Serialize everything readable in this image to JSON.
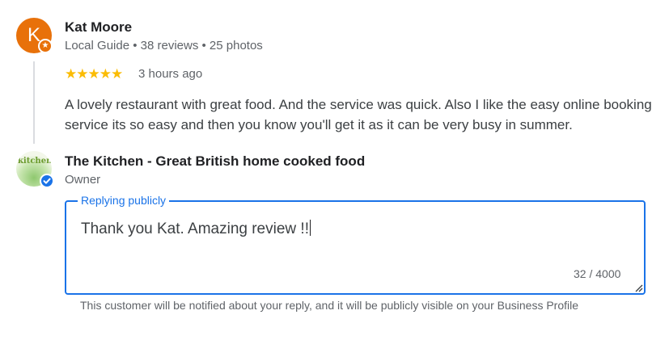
{
  "review": {
    "avatar_letter": "K",
    "reviewer_name": "Kat Moore",
    "reviewer_meta": "Local Guide • 38 reviews • 25 photos",
    "stars": "★★★★★",
    "rating": 5,
    "time": "3 hours ago",
    "text": "A lovely restaurant with great food. And the service was quick. Also I like the easy online booking service its so easy and then you know you'll get it as it can be very busy in summer."
  },
  "owner": {
    "logo_text": "kitchen",
    "name": "The Kitchen - Great British home cooked food",
    "role": "Owner"
  },
  "reply": {
    "legend": "Replying publicly",
    "value": "Thank you Kat. Amazing review !!",
    "char_count": "32 / 4000",
    "notice": "This customer will be notified about your reply, and it will be publicly visible on your Business Profile"
  },
  "colors": {
    "accent": "#1a73e8",
    "avatar": "#e8710a",
    "star": "#fbbc04"
  }
}
